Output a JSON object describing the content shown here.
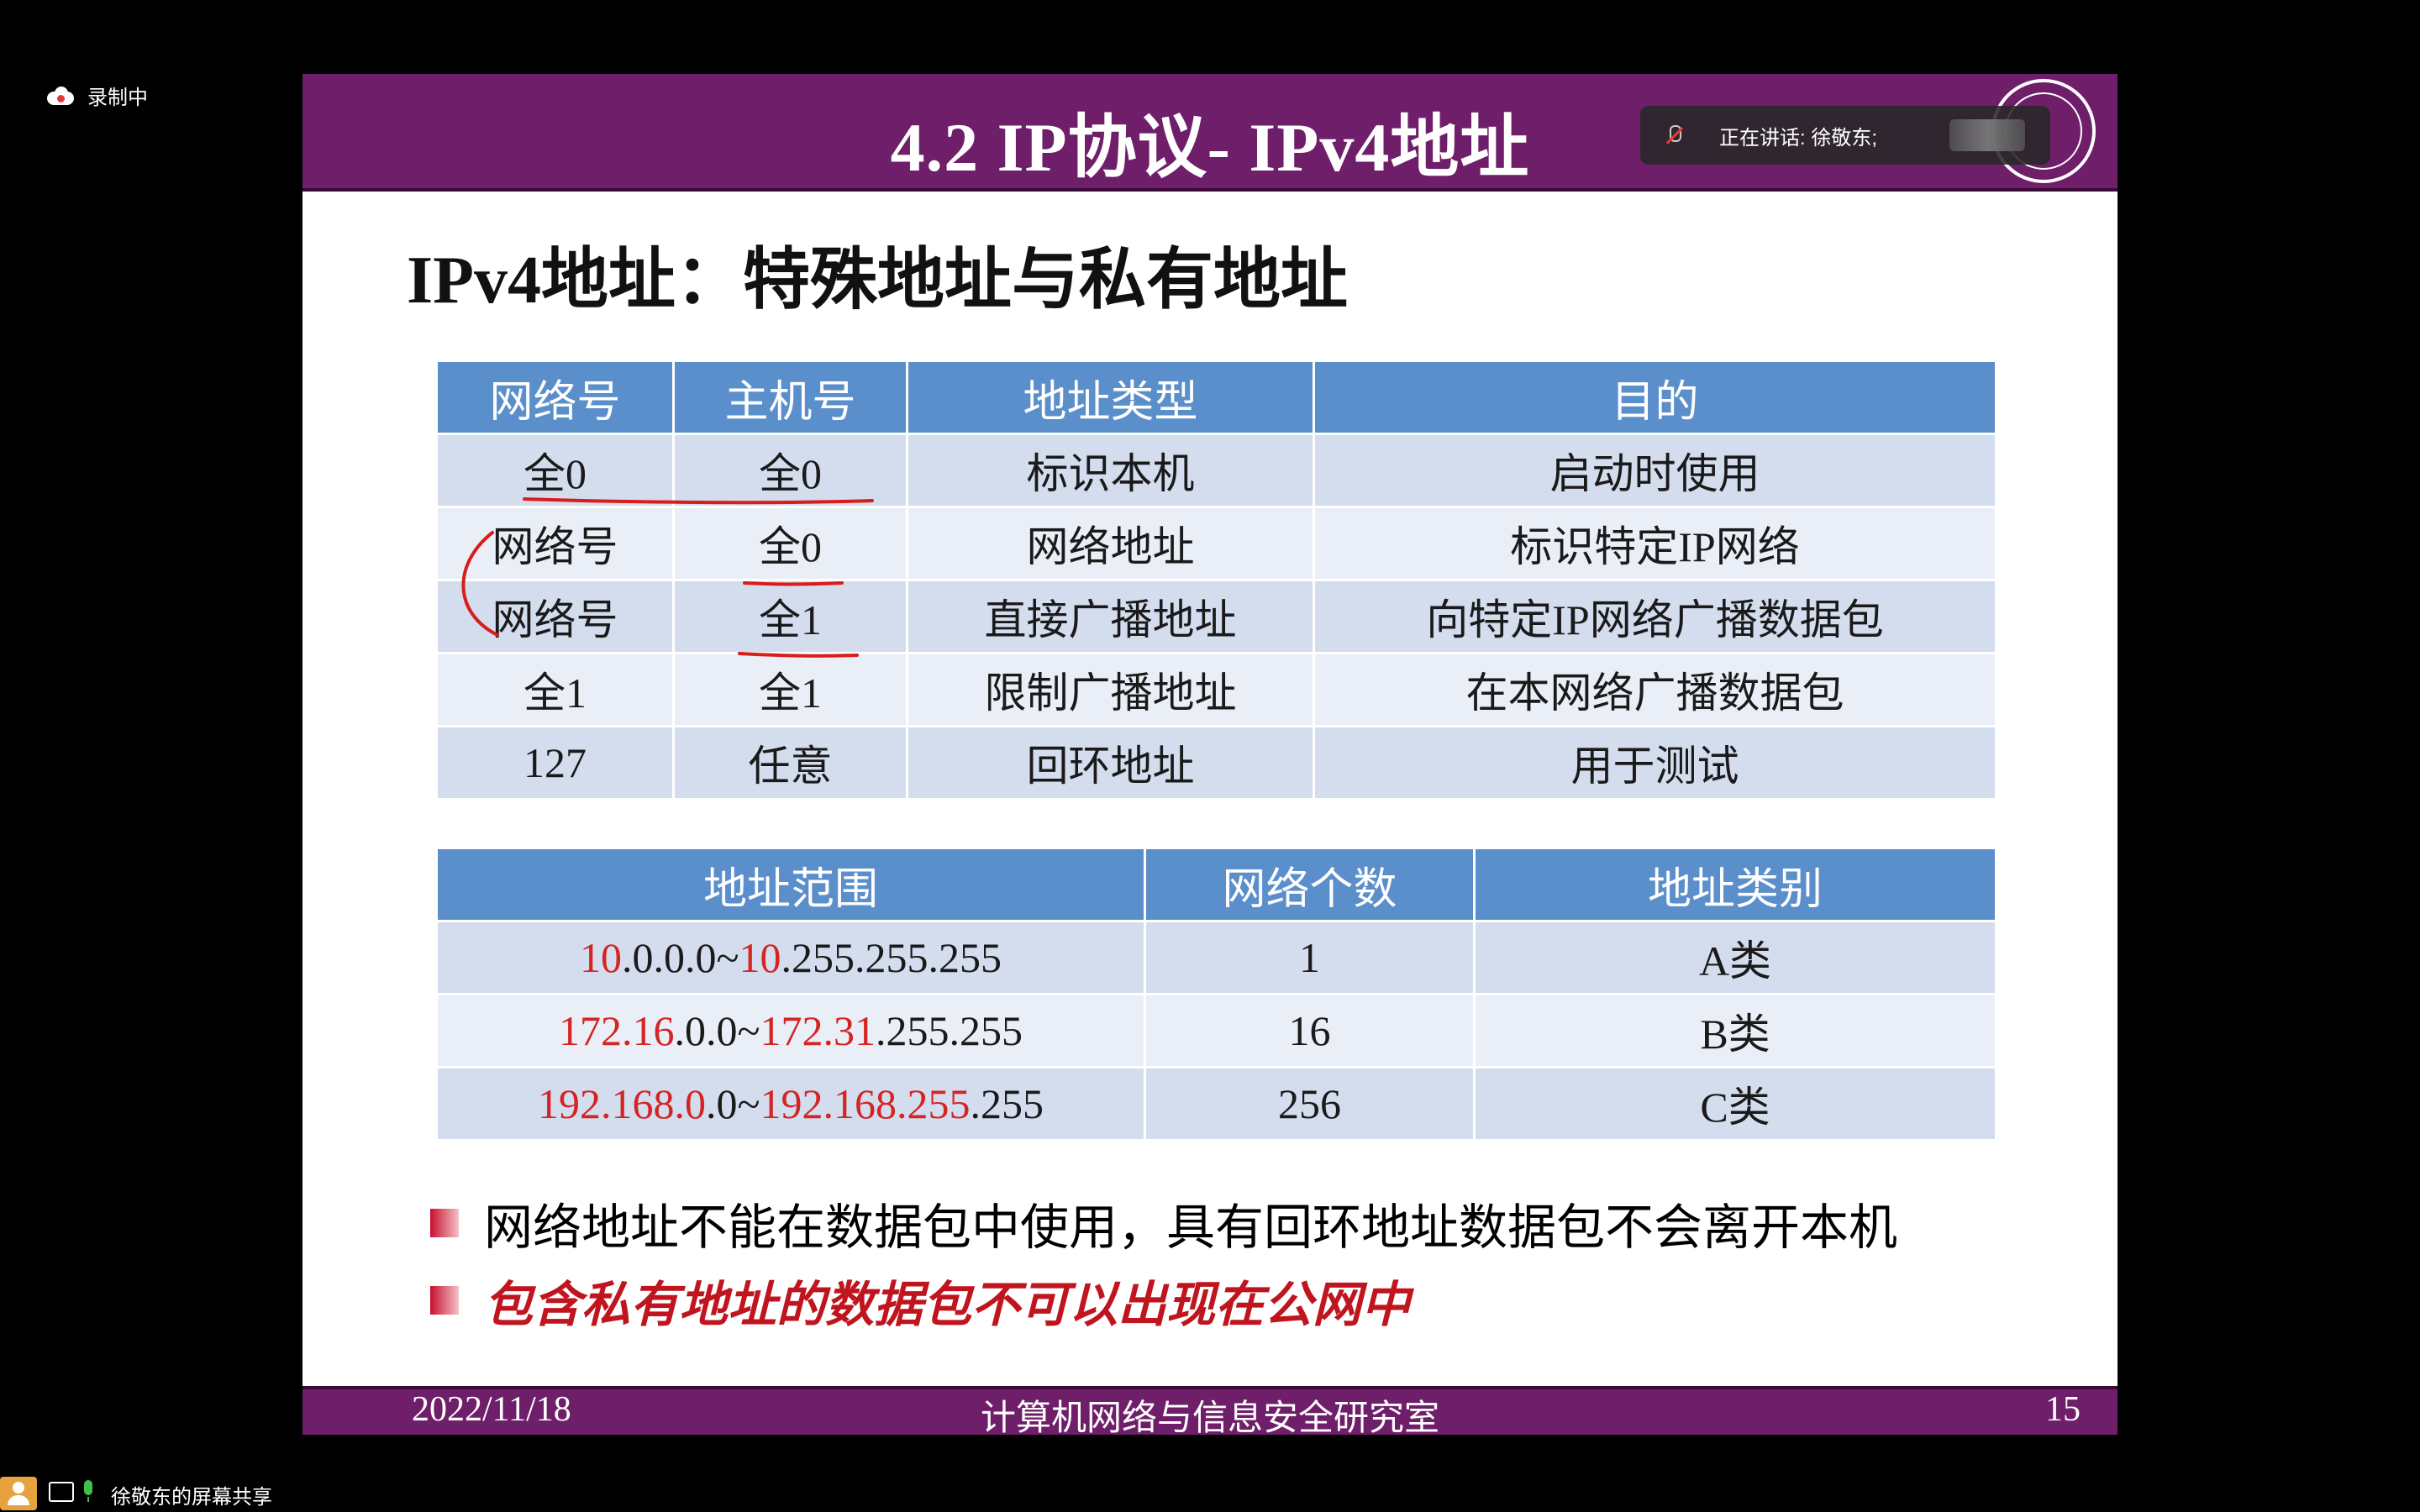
{
  "recording": {
    "label": "录制中"
  },
  "slide": {
    "title": "4.2 IP协议- IPv4地址",
    "heading": "IPv4地址：特殊地址与私有地址",
    "table1": {
      "headers": [
        "网络号",
        "主机号",
        "地址类型",
        "目的"
      ],
      "rows": [
        [
          "全0",
          "全0",
          "标识本机",
          "启动时使用"
        ],
        [
          "网络号",
          "全0",
          "网络地址",
          "标识特定IP网络"
        ],
        [
          "网络号",
          "全1",
          "直接广播地址",
          "向特定IP网络广播数据包"
        ],
        [
          "全1",
          "全1",
          "限制广播地址",
          "在本网络广播数据包"
        ],
        [
          "127",
          "任意",
          "回环地址",
          "用于测试"
        ]
      ]
    },
    "table2": {
      "headers": [
        "地址范围",
        "网络个数",
        "地址类别"
      ],
      "rows": [
        {
          "r1": "10",
          "n1": ".0.0.0~",
          "r2": "10",
          "n2": ".255.255.255",
          "count": "1",
          "class": "A类"
        },
        {
          "r1": "172.16",
          "n1": ".0.0~",
          "r2": "172.31",
          "n2": ".255.255",
          "count": "16",
          "class": "B类"
        },
        {
          "r1": "192.168.0",
          "n1": ".0~",
          "r2": "192.168.255",
          "n2": ".255",
          "count": "256",
          "class": "C类"
        }
      ]
    },
    "bullets": [
      "网络地址不能在数据包中使用，具有回环地址数据包不会离开本机",
      "包含私有地址的数据包不可以出现在公网中"
    ],
    "footer": {
      "date": "2022/11/18",
      "lab": "计算机网络与信息安全研究室",
      "page": "15"
    }
  },
  "speaking": {
    "text": "正在讲话: 徐敬东;"
  },
  "bottom_bar": {
    "share_label": "徐敬东的屏幕共享"
  },
  "colors": {
    "title_bar": "#6f1e6a",
    "header_cell": "#5b8fcb",
    "row_odd": "#d3ddee",
    "row_even": "#eaeff7",
    "private_red": "#d42424",
    "annotation": "#d91c1c"
  }
}
